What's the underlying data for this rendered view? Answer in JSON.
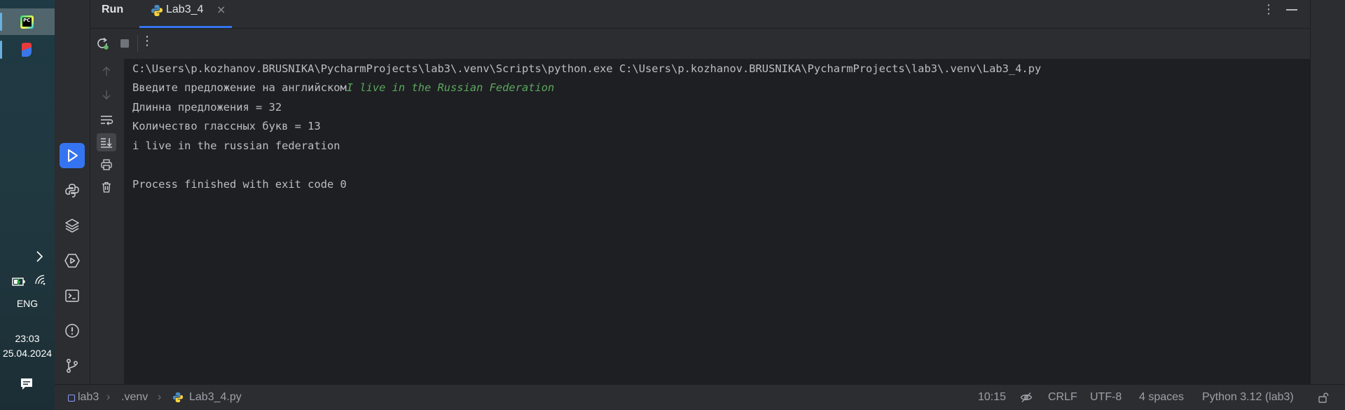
{
  "taskbar": {
    "language": "ENG",
    "time": "23:03",
    "date": "25.04.2024",
    "pycharm_icon_text": "PC"
  },
  "run_panel": {
    "title": "Run",
    "tab_label": "Lab3_4",
    "tab_close": "×",
    "more_glyph": "⋮"
  },
  "console": {
    "lines": [
      {
        "text": "C:\\Users\\p.kozhanov.BRUSNIKA\\PycharmProjects\\lab3\\.venv\\Scripts\\python.exe C:\\Users\\p.kozhanov.BRUSNIKA\\PycharmProjects\\lab3\\.venv\\Lab3_4.py"
      },
      {
        "prompt": "Введите предложение на английском",
        "input": "I live in the Russian Federation"
      },
      {
        "text": "Длинна предложения = 32"
      },
      {
        "text": "Количество глассных букв = 13"
      },
      {
        "text": "i live in the russian federation"
      },
      {
        "text": ""
      },
      {
        "text": "Process finished with exit code 0"
      }
    ]
  },
  "statusbar": {
    "breadcrumbs": [
      "lab3",
      ".venv",
      "Lab3_4.py"
    ],
    "position": "10:15",
    "line_separator": "CRLF",
    "encoding": "UTF-8",
    "indent": "4 spaces",
    "interpreter": "Python 3.12 (lab3)"
  },
  "colors": {
    "accent": "#3574f0",
    "user_input": "#5ba75e"
  }
}
